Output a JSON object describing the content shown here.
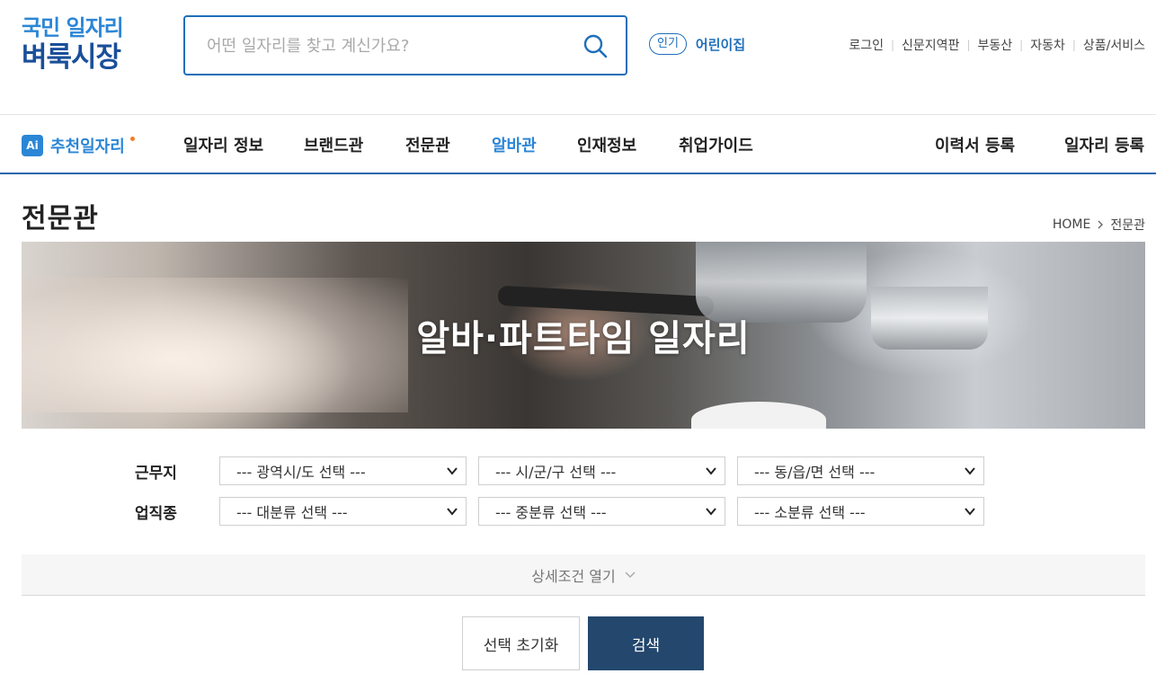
{
  "logo": {
    "line1": "국민 일자리",
    "line2": "벼룩시장"
  },
  "search": {
    "placeholder": "어떤 일자리를 찾고 계신가요?",
    "value": ""
  },
  "popular": {
    "badge": "인기",
    "keyword": "어린이집"
  },
  "util_links": [
    "로그인",
    "신문지역판",
    "부동산",
    "자동차",
    "상품/서비스"
  ],
  "nav": {
    "ai_label": "추천일자리",
    "items": [
      "일자리 정보",
      "브랜드관",
      "전문관",
      "알바관",
      "인재정보",
      "취업가이드"
    ],
    "active_item": "알바관",
    "right_items": [
      "이력서 등록",
      "일자리 등록"
    ]
  },
  "page": {
    "title": "전문관",
    "breadcrumb_home": "HOME",
    "breadcrumb_current": "전문관"
  },
  "banner": {
    "title": "알바·파트타임 일자리"
  },
  "filters": {
    "location_label": "근무지",
    "location_selects": [
      "--- 광역시/도 선택 ---",
      "--- 시/군/구 선택 ---",
      "--- 동/읍/면 선택 ---"
    ],
    "job_label": "업직종",
    "job_selects": [
      "--- 대분류 선택 ---",
      "--- 중분류 선택 ---",
      "--- 소분류 선택 ---"
    ]
  },
  "more": {
    "label": "상세조건 열기"
  },
  "buttons": {
    "reset": "선택 초기화",
    "search": "검색"
  },
  "colors": {
    "brand_blue": "#2b86d6",
    "brand_navy": "#1a4f9a",
    "search_button": "#23476d",
    "accent_dot": "#f07f2a"
  },
  "icons": {
    "search": "search-icon",
    "select_arrow": "chevron-down-icon",
    "breadcrumb_sep": "chevron-right-icon"
  }
}
